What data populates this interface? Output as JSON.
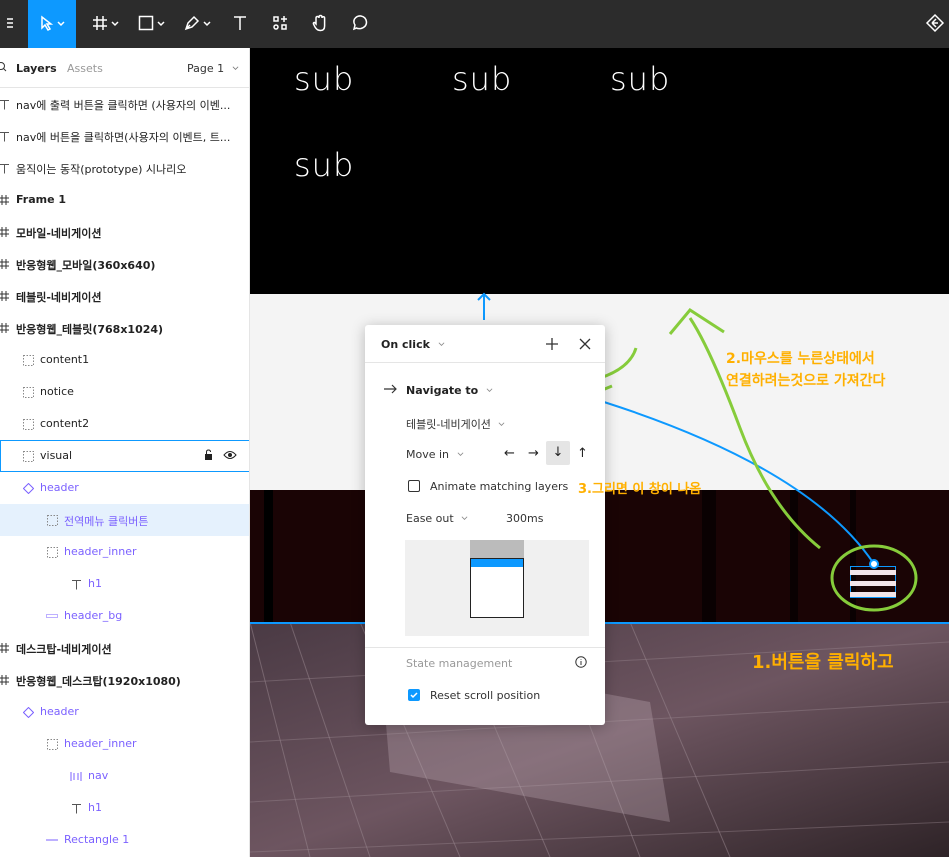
{
  "toolbar": {
    "tools": [
      {
        "name": "menu-icon"
      },
      {
        "name": "move-tool-icon"
      },
      {
        "name": "frame-tool-icon"
      },
      {
        "name": "shape-tool-icon"
      },
      {
        "name": "pen-tool-icon"
      },
      {
        "name": "text-tool-icon"
      },
      {
        "name": "resources-icon"
      },
      {
        "name": "hand-tool-icon"
      },
      {
        "name": "comment-tool-icon"
      },
      {
        "name": "present-icon"
      }
    ],
    "active_color": "#0d99ff"
  },
  "layers_panel": {
    "tab_layers": "Layers",
    "tab_assets": "Assets",
    "page": "Page 1",
    "items": [
      {
        "label": "nav에 출력 버튼을 클릭하면 (사용자의 이벤...",
        "icon": "text-icon"
      },
      {
        "label": "nav에 버튼을 클릭하면(사용자의 이벤트, 트...",
        "icon": "text-icon"
      },
      {
        "label": "움직이는 동작(prototype) 시나리오",
        "icon": "text-icon"
      },
      {
        "label": "Frame 1",
        "icon": "frame-icon"
      },
      {
        "label": "모바일-네비게이션",
        "icon": "frame-icon"
      },
      {
        "label": "반응형웹_모바일(360x640)",
        "icon": "frame-icon"
      },
      {
        "label": "테블릿-네비게이션",
        "icon": "frame-icon"
      },
      {
        "label": "반응형웹_테블릿(768x1024)",
        "icon": "frame-icon"
      },
      {
        "label": "content1",
        "icon": "group-icon"
      },
      {
        "label": "notice",
        "icon": "group-icon"
      },
      {
        "label": "content2",
        "icon": "group-icon"
      },
      {
        "label": "visual",
        "icon": "group-icon"
      },
      {
        "label": "header",
        "icon": "component-icon"
      },
      {
        "label": "전역메뉴 클릭버튼",
        "icon": "group-icon"
      },
      {
        "label": "header_inner",
        "icon": "group-icon"
      },
      {
        "label": "h1",
        "icon": "text-icon"
      },
      {
        "label": "header_bg",
        "icon": "rectangle-icon"
      },
      {
        "label": "데스크탑-네비게이션",
        "icon": "frame-icon"
      },
      {
        "label": "반응형웹_데스크탑(1920x1080)",
        "icon": "frame-icon"
      },
      {
        "label": "header",
        "icon": "component-icon"
      },
      {
        "label": "header_inner",
        "icon": "group-icon"
      },
      {
        "label": "nav",
        "icon": "auto-layout-icon"
      },
      {
        "label": "h1",
        "icon": "text-icon"
      },
      {
        "label": "Rectangle 1",
        "icon": "line-icon"
      }
    ]
  },
  "canvas": {
    "sub_labels": [
      "sub",
      "sub",
      "sub",
      "sub"
    ]
  },
  "popup": {
    "trigger": "On click",
    "action": "Navigate to",
    "destination": "테블릿-네비게이션",
    "animation": "Move in",
    "directions": [
      "←",
      "→",
      "↓",
      "↑"
    ],
    "selected_direction": "↓",
    "animate_matching": "Animate matching layers",
    "animate_matching_checked": false,
    "easing": "Ease out",
    "duration": "300ms",
    "state_section": "State management",
    "reset_scroll": "Reset scroll position",
    "reset_scroll_checked": true
  },
  "annotations": {
    "step1": "1.버튼을 클릭하고",
    "step2_line1": "2.마우스를 누른상태에서",
    "step2_line2": "연결하려는것으로 가져간다",
    "step3": "3.그리면 이 창이 나옴"
  }
}
